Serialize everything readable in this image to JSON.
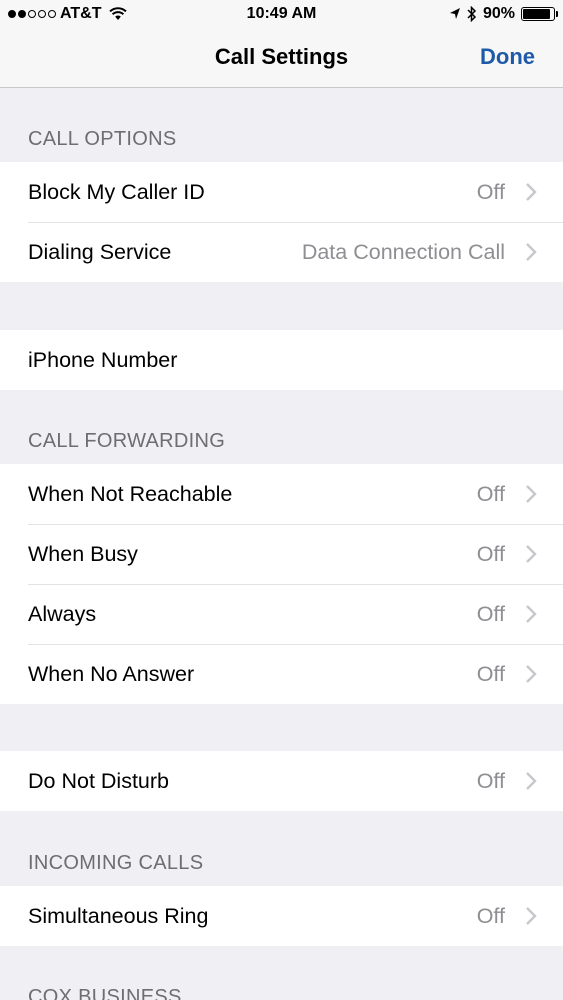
{
  "status_bar": {
    "carrier": "AT&T",
    "time": "10:49 AM",
    "battery": "90%",
    "battery_level": 0.9,
    "signal_bars_filled": 2,
    "signal_bars_total": 5
  },
  "nav": {
    "title": "Call Settings",
    "done_label": "Done",
    "accent_color": "#1f5aa8"
  },
  "sections": {
    "call_options": {
      "header": "CALL OPTIONS",
      "block_caller_id": {
        "label": "Block My Caller ID",
        "value": "Off"
      },
      "dialing_service": {
        "label": "Dialing Service",
        "value": "Data Connection Call"
      }
    },
    "number": {
      "iphone_number": {
        "label": "iPhone Number"
      }
    },
    "call_forwarding": {
      "header": "CALL FORWARDING",
      "not_reachable": {
        "label": "When Not Reachable",
        "value": "Off"
      },
      "busy": {
        "label": "When Busy",
        "value": "Off"
      },
      "always": {
        "label": "Always",
        "value": "Off"
      },
      "no_answer": {
        "label": "When No Answer",
        "value": "Off"
      }
    },
    "dnd": {
      "do_not_disturb": {
        "label": "Do Not Disturb",
        "value": "Off"
      }
    },
    "incoming_calls": {
      "header": "INCOMING CALLS",
      "simultaneous_ring": {
        "label": "Simultaneous Ring",
        "value": "Off"
      }
    },
    "cox_business": {
      "header": "COX BUSINESS"
    }
  },
  "icons": [
    "signal-icon",
    "wifi-icon",
    "location-icon",
    "bluetooth-icon",
    "battery-icon",
    "chevron-right-icon"
  ]
}
